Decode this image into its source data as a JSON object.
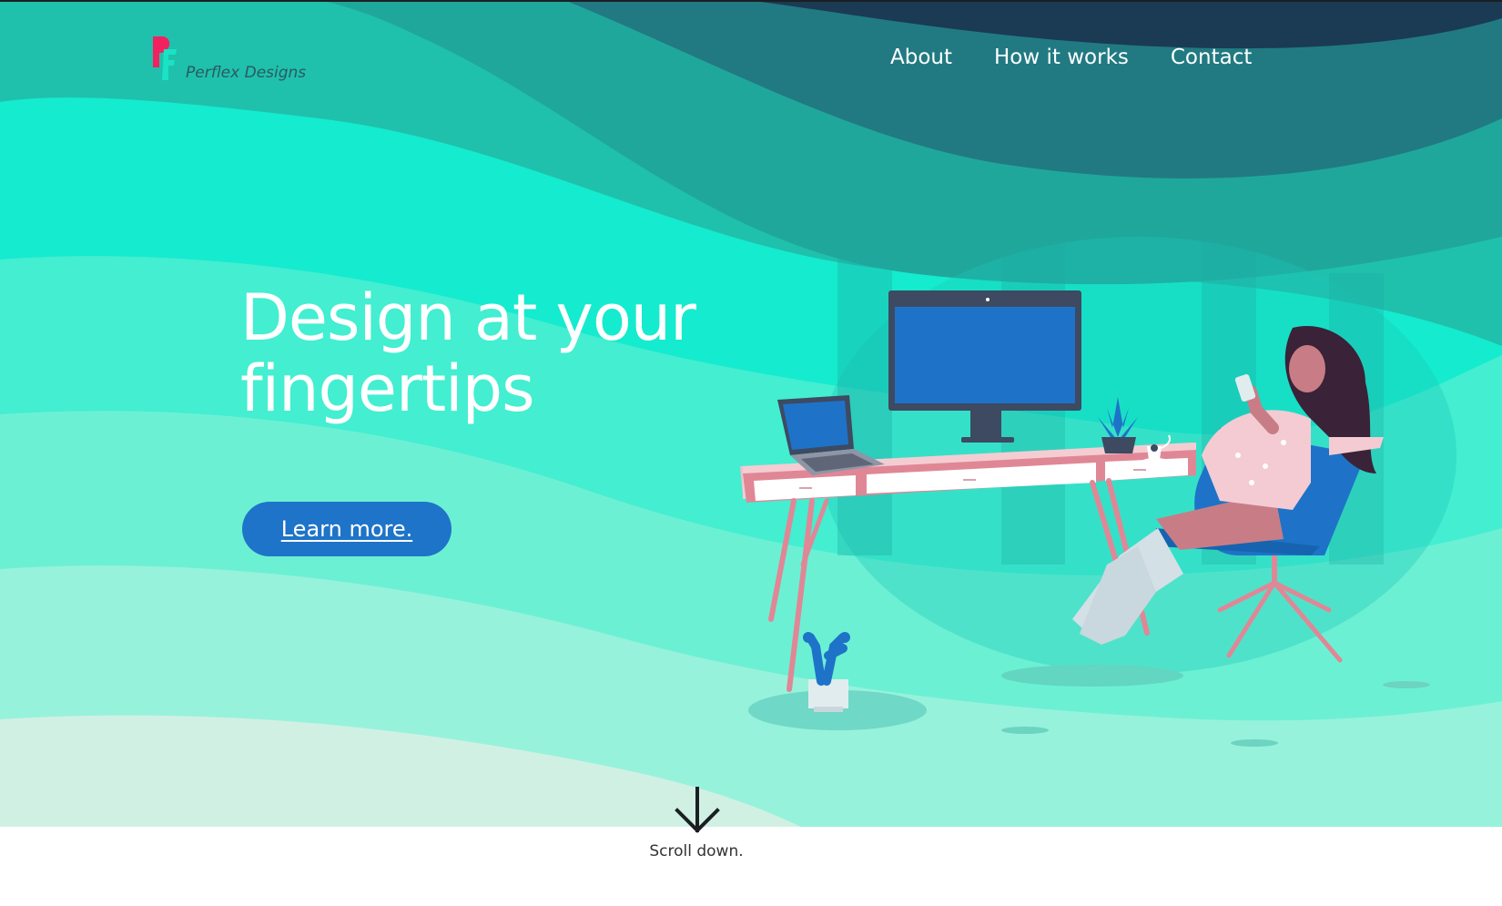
{
  "brand": {
    "name": "Perflex Designs",
    "logo_icon": "pf-monogram-icon",
    "colors": {
      "logo_pink": "#f1225f",
      "logo_cyan": "#19e3c4"
    }
  },
  "nav": {
    "items": [
      {
        "label": "About"
      },
      {
        "label": "How it works"
      },
      {
        "label": "Contact"
      }
    ]
  },
  "hero": {
    "headline_line1": "Design at your",
    "headline_line2": "fingertips",
    "cta_label": "Learn more.",
    "illustration_icon": "workspace-illustration-icon"
  },
  "footer_hint": {
    "arrow_icon": "arrow-down-icon",
    "label": "Scroll down."
  },
  "colors": {
    "cta_bg": "#1e74c8",
    "wave_dark": "#1b3a54",
    "wave_mid": "#21a79a",
    "wave_bright": "#15ebce",
    "wave_light": "#97f2db",
    "text_white": "#ffffff"
  }
}
